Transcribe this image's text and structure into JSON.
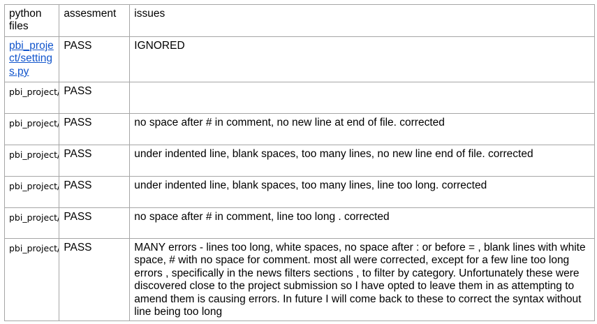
{
  "table": {
    "headers": [
      "python files",
      "assesment",
      "issues"
    ],
    "rows": [
      {
        "file": "pbi_project/settings.py",
        "assessment": "PASS",
        "issues": "IGNORED",
        "link": true
      },
      {
        "file": "pbi_project/urls.py",
        "assessment": "PASS",
        "issues": ""
      },
      {
        "file": "pbi_project/admin.py",
        "assessment": "PASS",
        "issues": "no space after # in comment, no new line at end of file. corrected"
      },
      {
        "file": "pbi_project/forms.py",
        "assessment": "PASS",
        "issues": "under indented line, blank spaces, too many lines, no new line end of file. corrected"
      },
      {
        "file": "pbi_project/models.py",
        "assessment": "PASS",
        "issues": "under indented line, blank spaces, too many lines, line too long. corrected"
      },
      {
        "file": "pbi_project/models.py",
        "assessment": "PASS",
        "issues": "no space after # in comment, line too long . corrected"
      },
      {
        "file": "pbi_project/views.py",
        "assessment": "PASS",
        "issues": "MANY errors - lines too long, white spaces, no space after : or before = , blank lines with white space, # with no space for comment. most all were corrected, except for a few line too long errors , specifically in the news filters sections , to filter by category. Unfortunately these were discovered close to the project submission so I have opted to leave them in as attempting to amend them is causing errors. In future I will come back to these to correct the syntax without line being too long"
      }
    ]
  }
}
